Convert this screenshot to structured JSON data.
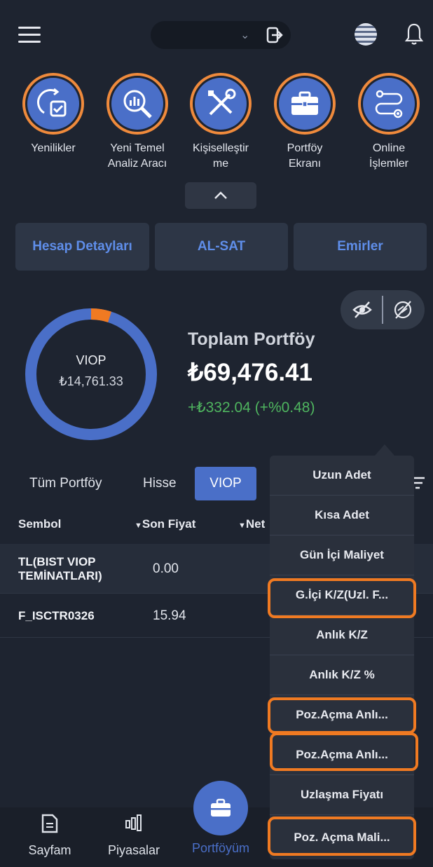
{
  "shortcuts": [
    {
      "label": "Yenilikler",
      "icon": "refresh-checklist-icon"
    },
    {
      "label": "Yeni Temel\nAnaliz Aracı",
      "icon": "magnifier-chart-icon"
    },
    {
      "label": "Kişiselleştir\nme",
      "icon": "tools-icon"
    },
    {
      "label": "Portföy\nEkranı",
      "icon": "briefcase-icon"
    },
    {
      "label": "Online\nİşlemler",
      "icon": "workflow-icon"
    }
  ],
  "actions": {
    "account_details": "Hesap Detayları",
    "buy_sell": "AL-SAT",
    "orders": "Emirler"
  },
  "portfolio": {
    "donut_label": "VIOP",
    "donut_value": "₺14,761.33",
    "total_title": "Toplam Portföy",
    "total_value": "₺69,476.41",
    "daily_change": "+₺332.04 (+%0.48)",
    "donut_share": 0.05
  },
  "tabs": {
    "all": "Tüm Portföy",
    "stock": "Hisse",
    "viop": "VIOP"
  },
  "table": {
    "headers": {
      "symbol": "Sembol",
      "last_price": "Son Fiyat",
      "net": "Net"
    },
    "rows": [
      {
        "symbol": "TL(BIST VIOP\nTEMİNATLARI)",
        "last_price": "0.00",
        "net": "("
      },
      {
        "symbol": "F_ISCTR0326",
        "last_price": "15.94",
        "net": "-"
      }
    ]
  },
  "column_menu": [
    "Uzun Adet",
    "Kısa Adet",
    "Gün İçi Maliyet",
    "G.İçi K/Z(Uzl. F...",
    "Anlık K/Z",
    "Anlık K/Z %",
    "Poz.Açma Anlı...",
    "Poz.Açma Anlı...",
    "Uzlaşma Fiyatı",
    "Poz. Açma Mali..."
  ],
  "bottom_nav": {
    "home": "Sayfam",
    "markets": "Piyasalar",
    "portfolio": "Portföyüm"
  },
  "colors": {
    "accent": "#4a6fc8",
    "highlight": "#f07a22",
    "positive": "#4fb55f",
    "donut_minor": "#f07a22"
  }
}
